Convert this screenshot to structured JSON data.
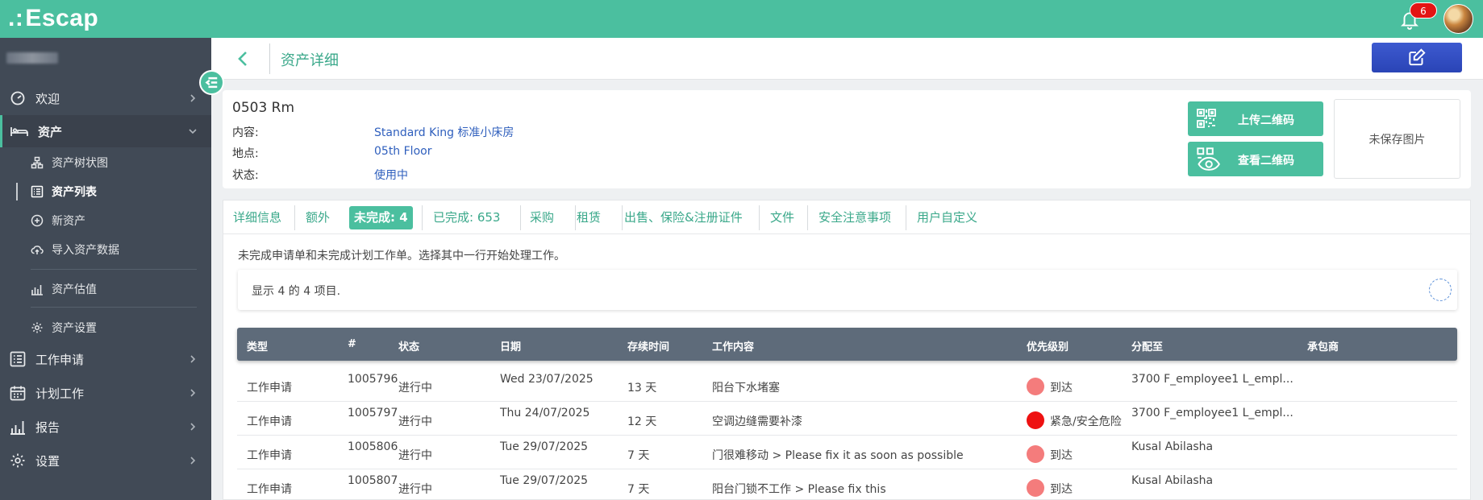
{
  "app": {
    "logo_text": "Escap",
    "notification_count": "6"
  },
  "sidebar": {
    "items": [
      {
        "label": "欢迎"
      },
      {
        "label": "资产"
      },
      {
        "label": "工作申请"
      },
      {
        "label": "计划工作"
      },
      {
        "label": "报告"
      },
      {
        "label": "设置"
      }
    ],
    "sub_items": [
      {
        "label": "资产树状图"
      },
      {
        "label": "资产列表"
      },
      {
        "label": "新资产"
      },
      {
        "label": "导入资产数据"
      },
      {
        "label": "资产估值"
      },
      {
        "label": "资产设置"
      }
    ]
  },
  "header": {
    "title": "资产详细"
  },
  "asset": {
    "name": "0503 Rm",
    "fields": [
      {
        "label": "内容:",
        "value": "Standard King 标准小床房"
      },
      {
        "label": "地点:",
        "value": "05th Floor"
      },
      {
        "label": "状态:",
        "value": "使用中"
      }
    ],
    "upload_qr_label": "上传二维码",
    "view_qr_label": "查看二维码",
    "photo_placeholder": "未保存图片"
  },
  "tabs": [
    {
      "label": "详细信息"
    },
    {
      "label": "额外"
    },
    {
      "label": "未完成: 4"
    },
    {
      "label": "已完成: 653"
    },
    {
      "label": "采购"
    },
    {
      "label": "租赁"
    },
    {
      "label": "出售、保险&注册证件"
    },
    {
      "label": "文件"
    },
    {
      "label": "安全注意事项"
    },
    {
      "label": "用户自定义"
    }
  ],
  "work": {
    "info_text": "未完成申请单和未完成计划工作单。选择其中一行开始处理工作。",
    "count_text": "显示 4 的 4 项目.",
    "columns": [
      "类型",
      "#",
      "状态",
      "日期",
      "存续时间",
      "工作内容",
      "优先级别",
      "分配至",
      "承包商"
    ],
    "rows": [
      {
        "type": "工作申请",
        "number": "1005796",
        "status": "进行中",
        "date": "Wed 23/07/2025",
        "duration": "13 天",
        "content": "阳台下水堵塞",
        "priority": "到达",
        "priority_color": "#f47c7c",
        "assigned": "3700 F_employee1 L_empl...",
        "contractor": ""
      },
      {
        "type": "工作申请",
        "number": "1005797",
        "status": "进行中",
        "date": "Thu 24/07/2025",
        "duration": "12 天",
        "content": "空调边缝需要补漆",
        "priority": "紧急/安全危险",
        "priority_color": "#ee1111",
        "assigned": "3700 F_employee1 L_empl...",
        "contractor": ""
      },
      {
        "type": "工作申请",
        "number": "1005806",
        "status": "进行中",
        "date": "Tue 29/07/2025",
        "duration": "7 天",
        "content": "门很难移动 > Please fix it as soon as possible",
        "priority": "到达",
        "priority_color": "#f47c7c",
        "assigned": "Kusal Abilasha",
        "contractor": ""
      },
      {
        "type": "工作申请",
        "number": "1005807",
        "status": "进行中",
        "date": "Tue 29/07/2025",
        "duration": "7 天",
        "content": "阳台门锁不工作 > Please fix this",
        "priority": "到达",
        "priority_color": "#f47c7c",
        "assigned": "Kusal Abilasha",
        "contractor": ""
      }
    ]
  },
  "colors": {
    "brand": "#4bbf9f",
    "sidebar": "#414a56",
    "link": "#2f5fbd",
    "edit_button": "#2a44b6",
    "table_header": "#5e6b7a"
  }
}
